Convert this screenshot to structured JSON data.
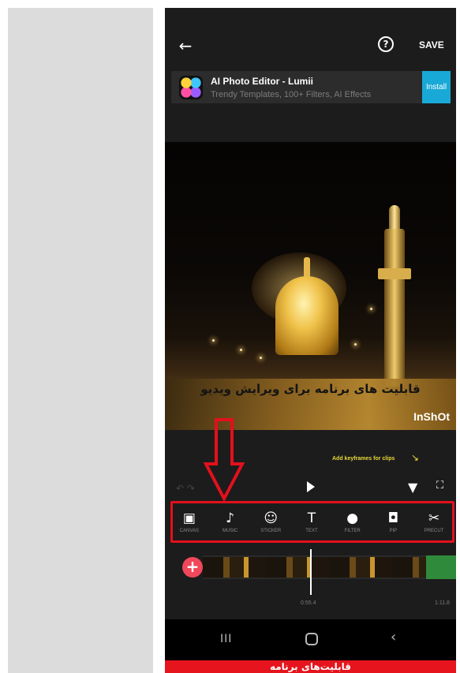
{
  "header": {
    "back_icon": "arrow-left-icon",
    "help_icon": "question-circle-icon",
    "save_label": "SAVE"
  },
  "ad": {
    "title": "AI Photo Editor - Lumii",
    "subtitle": "Trendy Templates, 100+ Filters, AI Effects",
    "install_label": "Install",
    "install_color": "#19a9d6"
  },
  "preview": {
    "caption": "قابلیت های برنامه برای ویرایش ویدیو",
    "watermark": "InShOt"
  },
  "hint": {
    "keyframes": "Add keyframes for clips",
    "accent": "#e8d83a"
  },
  "controls": {
    "play_icon": "play-icon",
    "keyframe_icon": "keyframe-add-icon",
    "fullscreen_icon": "fullscreen-icon"
  },
  "toolbar": {
    "items": [
      {
        "label": "CANVAS",
        "icon": "canvas-icon",
        "glyph": "▣"
      },
      {
        "label": "MUSIC",
        "icon": "music-note-icon",
        "glyph": "♪"
      },
      {
        "label": "STICKER",
        "icon": "smiley-icon",
        "glyph": "☺"
      },
      {
        "label": "TEXT",
        "icon": "text-icon",
        "glyph": "T"
      },
      {
        "label": "FILTER",
        "icon": "filter-icon",
        "glyph": "●"
      },
      {
        "label": "PIP",
        "icon": "pip-icon",
        "glyph": "◘"
      },
      {
        "label": "PRECUT",
        "icon": "scissors-icon",
        "glyph": "✂"
      }
    ]
  },
  "timeline": {
    "add_label": "+",
    "current_time": "0:55.4",
    "total_time": "1:11.8"
  },
  "navbar": {
    "recent_glyph": "III",
    "back_glyph": "‹"
  },
  "footer": {
    "banner": "قابلیت‌های برنامه",
    "color": "#e5141d"
  }
}
